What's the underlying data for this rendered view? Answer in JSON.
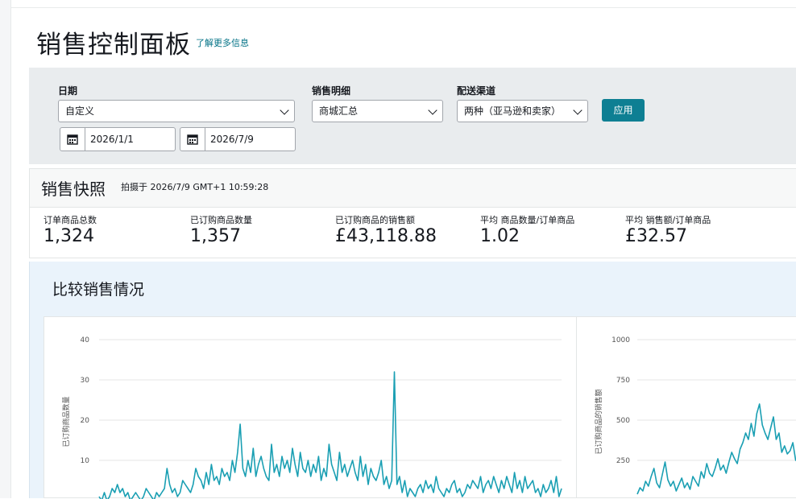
{
  "page": {
    "title": "销售控制面板",
    "learn_more": "了解更多信息"
  },
  "filters": {
    "date_label": "日期",
    "date_range_value": "自定义",
    "start_date": "2026/1/1",
    "end_date": "2026/7/9",
    "breakdown_label": "销售明细",
    "breakdown_value": "商城汇总",
    "channel_label": "配送渠道",
    "channel_value": "两种（亚马逊和卖家）",
    "apply_label": "应用"
  },
  "snapshot": {
    "title": "销售快照",
    "captured_at": "拍摄于 2026/7/9 GMT+1 10:59:28",
    "metrics": [
      {
        "label": "订单商品总数",
        "value": "1,324"
      },
      {
        "label": "已订购商品数量",
        "value": "1,357"
      },
      {
        "label": "已订购商品的销售额",
        "value": "£43,118.88"
      },
      {
        "label": "平均 商品数量/订单商品",
        "value": "1.02"
      },
      {
        "label": "平均 销售额/订单商品",
        "value": "£32.57"
      }
    ]
  },
  "compare": {
    "title": "比较销售情况"
  },
  "colors": {
    "accent": "#0e7f93",
    "line": "#1a9fb3",
    "link": "#007185"
  },
  "chart_data": [
    {
      "type": "line",
      "ylabel": "已订购商品数量",
      "ylim": [
        0,
        40
      ],
      "yticks": [
        "10",
        "20",
        "30",
        "40"
      ],
      "series": [
        {
          "values": [
            1,
            0,
            2,
            0,
            1,
            3,
            2,
            4,
            2,
            3,
            1,
            2,
            0,
            1,
            2,
            1,
            0,
            1,
            3,
            2,
            1,
            0,
            2,
            1,
            2,
            3,
            8,
            4,
            2,
            3,
            1,
            2,
            5,
            4,
            3,
            2,
            4,
            8,
            6,
            5,
            3,
            7,
            4,
            9,
            5,
            6,
            4,
            8,
            6,
            7,
            5,
            10,
            7,
            12,
            19,
            8,
            6,
            10,
            7,
            13,
            6,
            9,
            11,
            8,
            6,
            5,
            14,
            7,
            9,
            6,
            11,
            8,
            10,
            7,
            13,
            9,
            6,
            12,
            8,
            7,
            10,
            6,
            9,
            7,
            11,
            5,
            8,
            6,
            14,
            9,
            7,
            5,
            12,
            7,
            9,
            6,
            8,
            10,
            7,
            5,
            11,
            6,
            9,
            4,
            8,
            6,
            5,
            7,
            10,
            4,
            6,
            3,
            5,
            32,
            4,
            6,
            2,
            5,
            1,
            3,
            2,
            1,
            3,
            4,
            2,
            5,
            3,
            4,
            2,
            6,
            3,
            2,
            1,
            3,
            2,
            4,
            5,
            2,
            3,
            1,
            2,
            4,
            3,
            5,
            4,
            3,
            6,
            2,
            4,
            5,
            3,
            6,
            4,
            2,
            5,
            3,
            6,
            4,
            2,
            7,
            3,
            5,
            2,
            6,
            3,
            4,
            5,
            2,
            3,
            1,
            4,
            2,
            3,
            5,
            2,
            6,
            1,
            3
          ]
        }
      ]
    },
    {
      "type": "line",
      "ylabel": "已订购商品的销售额",
      "ylim": [
        0,
        1000
      ],
      "yticks": [
        "250",
        "500",
        "750",
        "1000"
      ],
      "series": [
        {
          "values": [
            40,
            80,
            60,
            120,
            90,
            150,
            200,
            110,
            80,
            160,
            240,
            130,
            90,
            120,
            60,
            100,
            140,
            80,
            110,
            70,
            150,
            120,
            90,
            180,
            140,
            230,
            170,
            150,
            200,
            260,
            190,
            220,
            170,
            240,
            300,
            260,
            230,
            320,
            360,
            420,
            380,
            480,
            400,
            540,
            600,
            470,
            420,
            380,
            450,
            520,
            380,
            420,
            300,
            340,
            290,
            310,
            360,
            250,
            290
          ]
        }
      ]
    }
  ]
}
